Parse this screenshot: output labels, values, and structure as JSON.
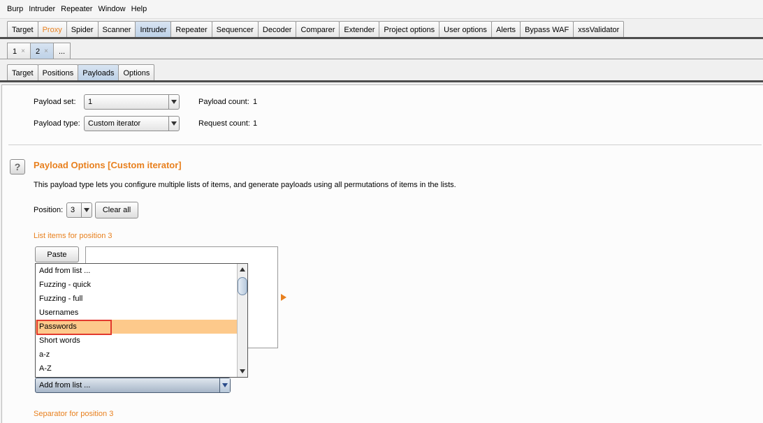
{
  "menubar": [
    "Burp",
    "Intruder",
    "Repeater",
    "Window",
    "Help"
  ],
  "main_tabs": [
    {
      "label": "Target"
    },
    {
      "label": "Proxy",
      "highlight": "orange"
    },
    {
      "label": "Spider"
    },
    {
      "label": "Scanner"
    },
    {
      "label": "Intruder",
      "active": true
    },
    {
      "label": "Repeater"
    },
    {
      "label": "Sequencer"
    },
    {
      "label": "Decoder"
    },
    {
      "label": "Comparer"
    },
    {
      "label": "Extender"
    },
    {
      "label": "Project options"
    },
    {
      "label": "User options"
    },
    {
      "label": "Alerts"
    },
    {
      "label": "Bypass WAF"
    },
    {
      "label": "xssValidator"
    }
  ],
  "attack_tabs": [
    {
      "label": "1",
      "close": "×"
    },
    {
      "label": "2",
      "close": "×",
      "active": true
    },
    {
      "label": "..."
    }
  ],
  "sub_tabs": [
    {
      "label": "Target"
    },
    {
      "label": "Positions"
    },
    {
      "label": "Payloads",
      "active": true
    },
    {
      "label": "Options"
    }
  ],
  "payload": {
    "set_label": "Payload set:",
    "set_value": "1",
    "count_label": "Payload count:",
    "count_value": "1",
    "type_label": "Payload type:",
    "type_value": "Custom iterator",
    "request_label": "Request count:",
    "request_value": "1"
  },
  "options": {
    "help_glyph": "?",
    "title": "Payload Options [Custom iterator]",
    "description": "This payload type lets you configure multiple lists of items, and generate payloads using all permutations of items in the lists.",
    "position_label": "Position:",
    "position_value": "3",
    "clear_all": "Clear all",
    "list_items_label": "List items for position 3",
    "paste": "Paste",
    "add_combo_value": "Add from list ...",
    "separator_label": "Separator for position 3"
  },
  "dropdown": {
    "items": [
      "Add from list ...",
      "Fuzzing - quick",
      "Fuzzing - full",
      "Usernames",
      "Passwords",
      "Short words",
      "a-z",
      "A-Z"
    ],
    "selected_index": 4
  },
  "colors": {
    "accent_orange": "#e8801e",
    "selection": "#fdc98b",
    "highlight_box": "#e23a2e",
    "active_tab": "#bcd0e6"
  }
}
